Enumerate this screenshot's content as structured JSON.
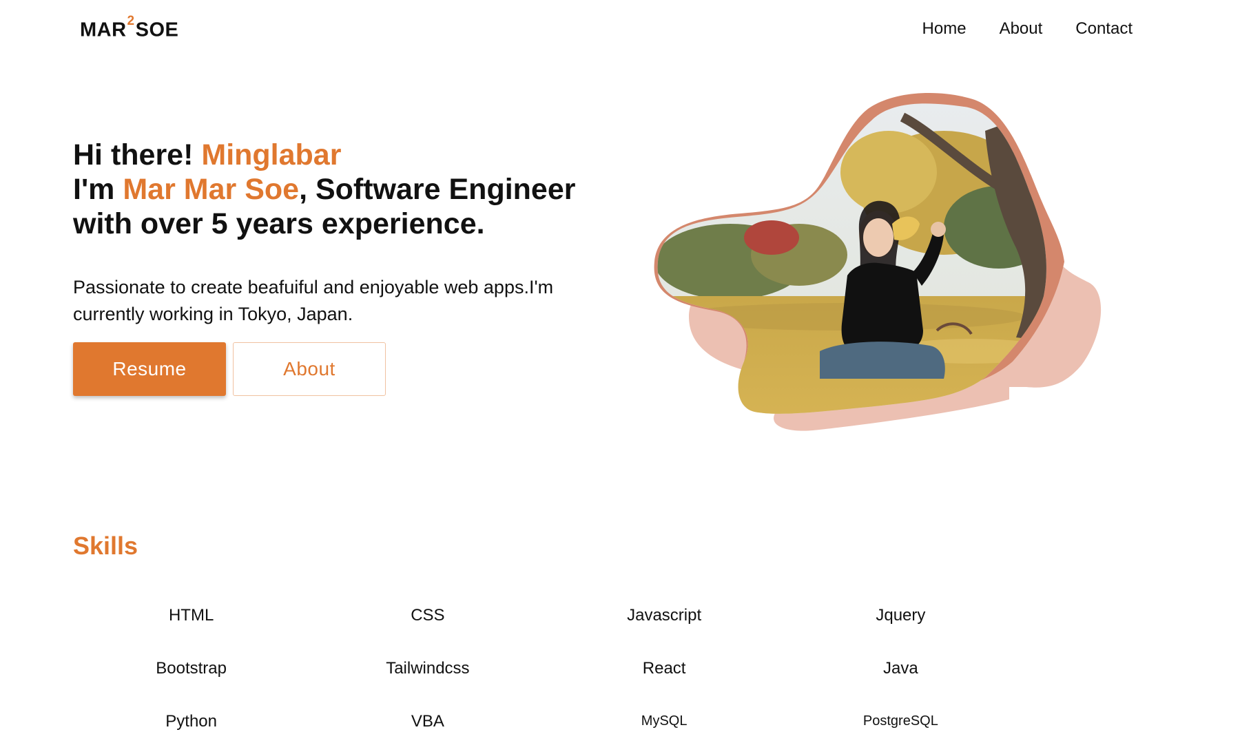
{
  "header": {
    "logo": {
      "left": "MAR",
      "sup": "2",
      "right": "SOE"
    },
    "nav": [
      {
        "label": "Home"
      },
      {
        "label": "About"
      },
      {
        "label": "Contact"
      }
    ]
  },
  "hero": {
    "line1_prefix": "Hi there! ",
    "line1_accent": "Minglabar",
    "line2_prefix": "I'm ",
    "line2_accent": "Mar Mar Soe",
    "line2_suffix": ", Software Engineer",
    "line3": "with over 5 years experience.",
    "description": "Passionate to create beafuiful and enjoyable web apps.I'm currently working in Tokyo, Japan.",
    "resume_label": "Resume",
    "about_label": "About"
  },
  "skills": {
    "title": "Skills",
    "items": [
      {
        "label": "HTML"
      },
      {
        "label": "CSS"
      },
      {
        "label": "Javascript"
      },
      {
        "label": "Jquery"
      },
      {
        "label": "Bootstrap"
      },
      {
        "label": "Tailwindcss"
      },
      {
        "label": "React"
      },
      {
        "label": "Java"
      },
      {
        "label": "Python"
      },
      {
        "label": "VBA"
      },
      {
        "label": "MySQL"
      },
      {
        "label": "PostgreSQL"
      }
    ]
  },
  "colors": {
    "accent": "#e0782f",
    "blob_dark": "#d4876c",
    "blob_light": "#ecc0b2"
  }
}
